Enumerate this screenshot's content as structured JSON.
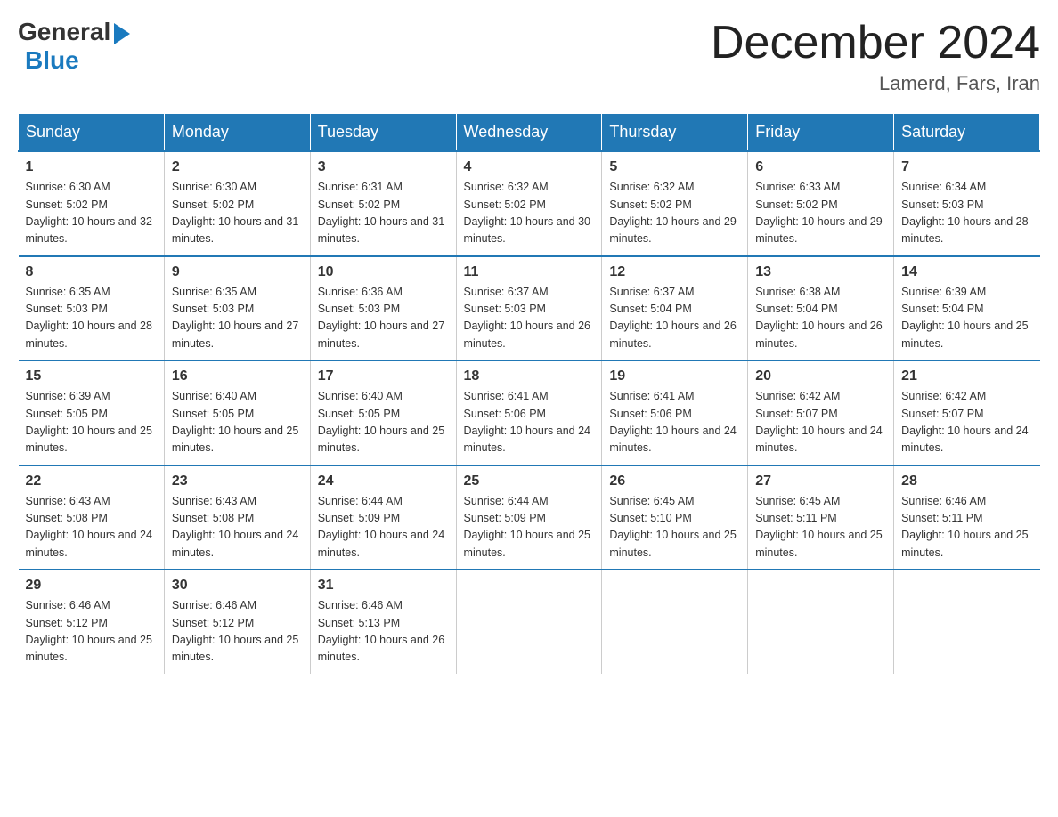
{
  "logo": {
    "general": "General",
    "blue": "Blue"
  },
  "title": "December 2024",
  "location": "Lamerd, Fars, Iran",
  "days_header": [
    "Sunday",
    "Monday",
    "Tuesday",
    "Wednesday",
    "Thursday",
    "Friday",
    "Saturday"
  ],
  "weeks": [
    [
      {
        "day": "1",
        "sunrise": "6:30 AM",
        "sunset": "5:02 PM",
        "daylight": "10 hours and 32 minutes."
      },
      {
        "day": "2",
        "sunrise": "6:30 AM",
        "sunset": "5:02 PM",
        "daylight": "10 hours and 31 minutes."
      },
      {
        "day": "3",
        "sunrise": "6:31 AM",
        "sunset": "5:02 PM",
        "daylight": "10 hours and 31 minutes."
      },
      {
        "day": "4",
        "sunrise": "6:32 AM",
        "sunset": "5:02 PM",
        "daylight": "10 hours and 30 minutes."
      },
      {
        "day": "5",
        "sunrise": "6:32 AM",
        "sunset": "5:02 PM",
        "daylight": "10 hours and 29 minutes."
      },
      {
        "day": "6",
        "sunrise": "6:33 AM",
        "sunset": "5:02 PM",
        "daylight": "10 hours and 29 minutes."
      },
      {
        "day": "7",
        "sunrise": "6:34 AM",
        "sunset": "5:03 PM",
        "daylight": "10 hours and 28 minutes."
      }
    ],
    [
      {
        "day": "8",
        "sunrise": "6:35 AM",
        "sunset": "5:03 PM",
        "daylight": "10 hours and 28 minutes."
      },
      {
        "day": "9",
        "sunrise": "6:35 AM",
        "sunset": "5:03 PM",
        "daylight": "10 hours and 27 minutes."
      },
      {
        "day": "10",
        "sunrise": "6:36 AM",
        "sunset": "5:03 PM",
        "daylight": "10 hours and 27 minutes."
      },
      {
        "day": "11",
        "sunrise": "6:37 AM",
        "sunset": "5:03 PM",
        "daylight": "10 hours and 26 minutes."
      },
      {
        "day": "12",
        "sunrise": "6:37 AM",
        "sunset": "5:04 PM",
        "daylight": "10 hours and 26 minutes."
      },
      {
        "day": "13",
        "sunrise": "6:38 AM",
        "sunset": "5:04 PM",
        "daylight": "10 hours and 26 minutes."
      },
      {
        "day": "14",
        "sunrise": "6:39 AM",
        "sunset": "5:04 PM",
        "daylight": "10 hours and 25 minutes."
      }
    ],
    [
      {
        "day": "15",
        "sunrise": "6:39 AM",
        "sunset": "5:05 PM",
        "daylight": "10 hours and 25 minutes."
      },
      {
        "day": "16",
        "sunrise": "6:40 AM",
        "sunset": "5:05 PM",
        "daylight": "10 hours and 25 minutes."
      },
      {
        "day": "17",
        "sunrise": "6:40 AM",
        "sunset": "5:05 PM",
        "daylight": "10 hours and 25 minutes."
      },
      {
        "day": "18",
        "sunrise": "6:41 AM",
        "sunset": "5:06 PM",
        "daylight": "10 hours and 24 minutes."
      },
      {
        "day": "19",
        "sunrise": "6:41 AM",
        "sunset": "5:06 PM",
        "daylight": "10 hours and 24 minutes."
      },
      {
        "day": "20",
        "sunrise": "6:42 AM",
        "sunset": "5:07 PM",
        "daylight": "10 hours and 24 minutes."
      },
      {
        "day": "21",
        "sunrise": "6:42 AM",
        "sunset": "5:07 PM",
        "daylight": "10 hours and 24 minutes."
      }
    ],
    [
      {
        "day": "22",
        "sunrise": "6:43 AM",
        "sunset": "5:08 PM",
        "daylight": "10 hours and 24 minutes."
      },
      {
        "day": "23",
        "sunrise": "6:43 AM",
        "sunset": "5:08 PM",
        "daylight": "10 hours and 24 minutes."
      },
      {
        "day": "24",
        "sunrise": "6:44 AM",
        "sunset": "5:09 PM",
        "daylight": "10 hours and 24 minutes."
      },
      {
        "day": "25",
        "sunrise": "6:44 AM",
        "sunset": "5:09 PM",
        "daylight": "10 hours and 25 minutes."
      },
      {
        "day": "26",
        "sunrise": "6:45 AM",
        "sunset": "5:10 PM",
        "daylight": "10 hours and 25 minutes."
      },
      {
        "day": "27",
        "sunrise": "6:45 AM",
        "sunset": "5:11 PM",
        "daylight": "10 hours and 25 minutes."
      },
      {
        "day": "28",
        "sunrise": "6:46 AM",
        "sunset": "5:11 PM",
        "daylight": "10 hours and 25 minutes."
      }
    ],
    [
      {
        "day": "29",
        "sunrise": "6:46 AM",
        "sunset": "5:12 PM",
        "daylight": "10 hours and 25 minutes."
      },
      {
        "day": "30",
        "sunrise": "6:46 AM",
        "sunset": "5:12 PM",
        "daylight": "10 hours and 25 minutes."
      },
      {
        "day": "31",
        "sunrise": "6:46 AM",
        "sunset": "5:13 PM",
        "daylight": "10 hours and 26 minutes."
      },
      null,
      null,
      null,
      null
    ]
  ]
}
